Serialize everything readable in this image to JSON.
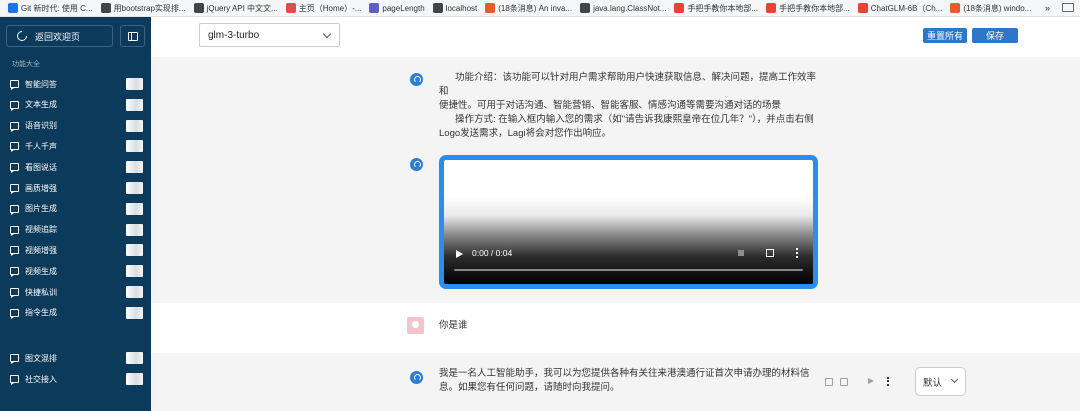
{
  "bookmarks": {
    "items": [
      {
        "label": "Git 新时代: 使用 C...",
        "color": "#1a73e8"
      },
      {
        "label": "用bootstrap实现排...",
        "color": "#444444"
      },
      {
        "label": "jQuery API 中文文...",
        "color": "#444444"
      },
      {
        "label": "主页（Home）-...",
        "color": "#e04b4b"
      },
      {
        "label": "pageLength",
        "color": "#5b5fc7"
      },
      {
        "label": "localhost",
        "color": "#444444"
      },
      {
        "label": "(18条消息) An inva...",
        "color": "#e85c2a"
      },
      {
        "label": "java.lang.ClassNot...",
        "color": "#444444"
      },
      {
        "label": "手把手教你本地部...",
        "color": "#ea4335"
      },
      {
        "label": "手把手教你本地部...",
        "color": "#ea4335"
      },
      {
        "label": "ChatGLM-6B（Ch...",
        "color": "#ea4335"
      },
      {
        "label": "(18条消息) windo...",
        "color": "#e85c2a"
      }
    ],
    "more": "»"
  },
  "sidebar": {
    "back_label": "返回欢迎页",
    "section_label": "功能大全",
    "items": [
      {
        "label": "智能问答"
      },
      {
        "label": "文本生成"
      },
      {
        "label": "语音识别"
      },
      {
        "label": "千人千声"
      },
      {
        "label": "看图说话"
      },
      {
        "label": "画质增强"
      },
      {
        "label": "图片生成"
      },
      {
        "label": "视频追踪"
      },
      {
        "label": "视频增强"
      },
      {
        "label": "视频生成"
      },
      {
        "label": "快捷私训"
      },
      {
        "label": "指令生成"
      }
    ],
    "bottom_items": [
      {
        "label": "图文混排"
      },
      {
        "label": "社交接入"
      }
    ]
  },
  "toolbar": {
    "model_value": "glm-3-turbo",
    "reset_label": "重置所有",
    "save_label": "保存"
  },
  "chat": {
    "intro_line1": "功能介绍：该功能可以针对用户需求帮助用户快速获取信息、解决问题，提高工作效率和",
    "intro_line2": "便捷性。可用于对话沟通、智能营销、智能客服、情感沟通等需要沟通对话的场景",
    "intro_line3": "操作方式: 在输入框内输入您的需求（如\"请告诉我康熙皇帝在位几年？\"），并点击右侧",
    "intro_line4": "Logo发送需求，Lagi将会对您作出响应。",
    "video_time": "0:00 / 0:04",
    "user_message": "你是谁",
    "bot_reply_line1": "我是一名人工智能助手，我可以为您提供各种有关往来港澳通行证首次申请办理的材料信",
    "bot_reply_line2": "息。如果您有任何问题，请随时向我提问。",
    "voice_value": "默认"
  },
  "colors": {
    "sidebar_bg": "#0c3a5b",
    "accent": "#2d77c8",
    "video_border": "#2a8ef0"
  }
}
